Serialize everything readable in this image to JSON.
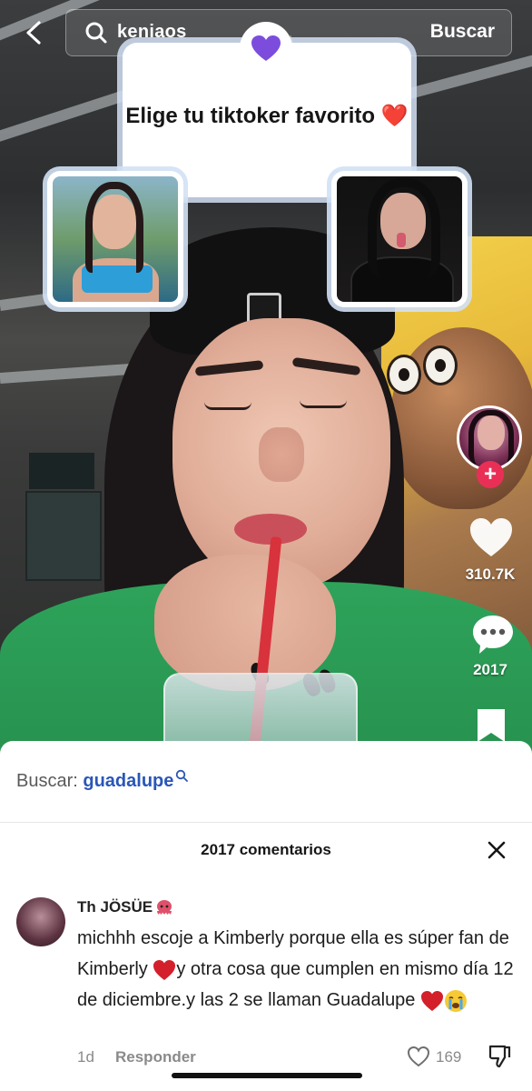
{
  "header": {
    "search_query": "keniaos",
    "search_button": "Buscar"
  },
  "poll": {
    "title": "Elige tu tiktoker favorito ❤️",
    "accent_color": "#7c4ddc"
  },
  "rail": {
    "like_count": "310.7K",
    "comment_count": "2017"
  },
  "sheet": {
    "search_label": "Buscar:",
    "search_term": "guadalupe",
    "comments_title": "2017 comentarios"
  },
  "comment": {
    "username": "Th JÖSÜE",
    "text_part1": "michhh escoje a Kimberly porque ella es súper fan de Kimberly ",
    "text_part2": "y otra cosa que cumplen en mismo día 12 de diciembre.y las 2 se llaman Guadalupe ",
    "time": "1d",
    "reply": "Responder",
    "likes": "169"
  },
  "colors": {
    "follow_red": "#ea2f56",
    "link_blue": "#2a56b8",
    "heart_red": "#d3202b"
  }
}
